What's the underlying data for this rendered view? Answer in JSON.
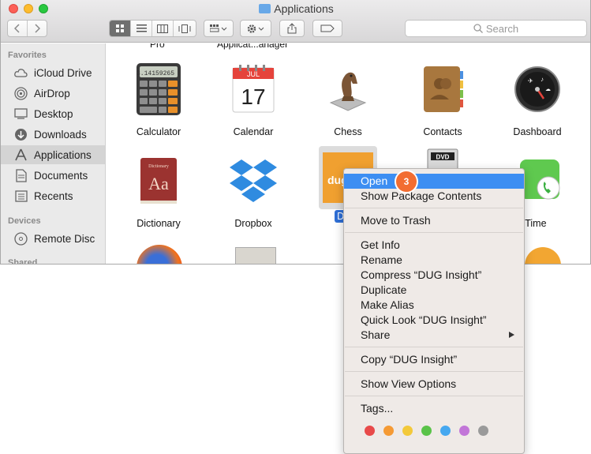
{
  "window": {
    "title": "Applications",
    "search_placeholder": "Search"
  },
  "sidebar": {
    "favorites_label": "Favorites",
    "devices_label": "Devices",
    "shared_label": "Shared",
    "items": [
      {
        "label": "iCloud Drive",
        "icon": "cloud-icon"
      },
      {
        "label": "AirDrop",
        "icon": "airdrop-icon"
      },
      {
        "label": "Desktop",
        "icon": "desktop-icon"
      },
      {
        "label": "Downloads",
        "icon": "downloads-icon"
      },
      {
        "label": "Applications",
        "icon": "applications-icon",
        "active": true
      },
      {
        "label": "Documents",
        "icon": "documents-icon"
      },
      {
        "label": "Recents",
        "icon": "recents-icon"
      }
    ],
    "devices": [
      {
        "label": "Remote Disc",
        "icon": "disc-icon"
      }
    ]
  },
  "content": {
    "cut_labels": [
      "Pro",
      "Applicat...anager"
    ],
    "apps": [
      {
        "label": "Calculator",
        "icon": "calculator-icon"
      },
      {
        "label": "Calendar",
        "icon": "calendar-icon",
        "month": "JUL",
        "day": "17"
      },
      {
        "label": "Chess",
        "icon": "chess-icon"
      },
      {
        "label": "Contacts",
        "icon": "contacts-icon"
      },
      {
        "label": "Dashboard",
        "icon": "dashboard-icon"
      },
      {
        "label": "Dictionary",
        "icon": "dictionary-icon",
        "icon_text": "Aa",
        "icon_small_text": "Dictionary"
      },
      {
        "label": "Dropbox",
        "icon": "dropbox-icon"
      },
      {
        "label": "DUG",
        "icon": "dug-insight-icon",
        "selected": true
      },
      {
        "label": "",
        "icon": "dvd-player-icon",
        "icon_text": "DVD"
      },
      {
        "label": "ceTime",
        "icon": "facetime-icon"
      }
    ],
    "calculator_display": "3.14159265"
  },
  "context_menu": {
    "items": [
      {
        "label": "Open",
        "highlighted": true
      },
      {
        "label": "Show Package Contents"
      },
      {
        "label": "Move to Trash"
      },
      {
        "label": "Get Info"
      },
      {
        "label": "Rename"
      },
      {
        "label": "Compress “DUG Insight”"
      },
      {
        "label": "Duplicate"
      },
      {
        "label": "Make Alias"
      },
      {
        "label": "Quick Look “DUG Insight”"
      },
      {
        "label": "Share",
        "submenu": true
      },
      {
        "label": "Copy “DUG Insight”"
      },
      {
        "label": "Show View Options"
      },
      {
        "label": "Tags..."
      }
    ],
    "tag_colors": [
      "#e84a4a",
      "#f59a34",
      "#f3c93a",
      "#5ac349",
      "#46a8f0",
      "#c276d8",
      "#9a9a9a"
    ]
  },
  "callout": {
    "step": "3",
    "color": "#f26d31"
  }
}
